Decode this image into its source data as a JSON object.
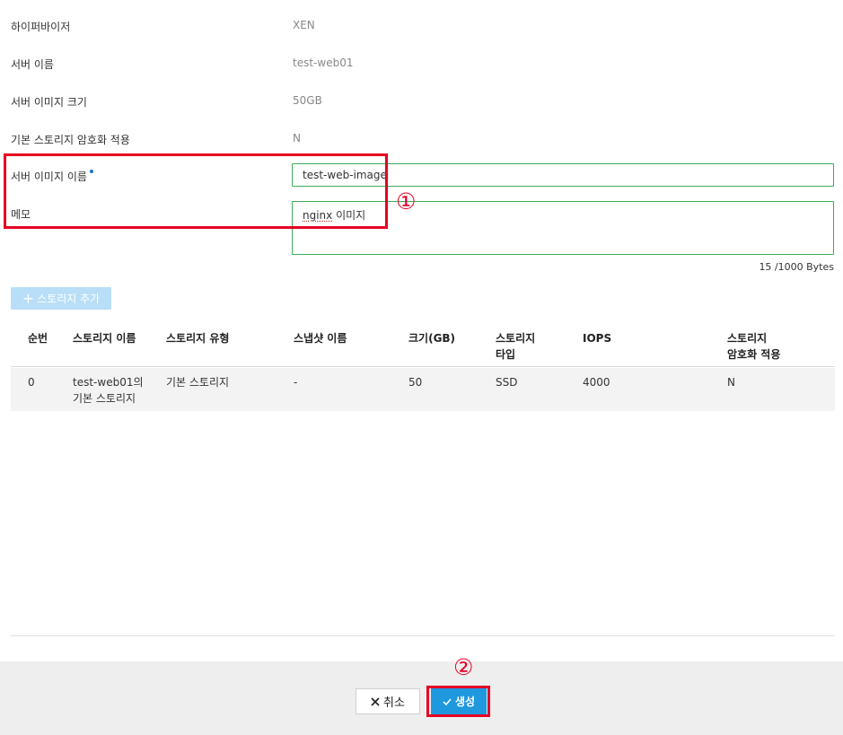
{
  "details": [
    {
      "label": "하이퍼바이저",
      "value": "XEN"
    },
    {
      "label": "서버 이름",
      "value": "test-web01"
    },
    {
      "label": "서버 이미지 크기",
      "value": "50GB"
    },
    {
      "label": "기본 스토리지 암호화 적용",
      "value": "N"
    }
  ],
  "form": {
    "image_name_label": "서버 이미지 이름",
    "image_name_value": "test-web-image",
    "memo_label": "메모",
    "memo_value_word": "nginx",
    "memo_value_rest": " 이미지",
    "byte_counter": "15 /1000 Bytes"
  },
  "add_storage_label": "스토리지 추가",
  "table": {
    "headers": [
      [
        "순번"
      ],
      [
        "스토리지 이름"
      ],
      [
        "스토리지 유형"
      ],
      [
        "스냅샷 이름"
      ],
      [
        "크기(GB)"
      ],
      [
        "스토리지",
        "타입"
      ],
      [
        "IOPS"
      ],
      [
        "스토리지",
        "암호화 적용"
      ]
    ],
    "rows": [
      {
        "cells": [
          [
            "0"
          ],
          [
            "test-web01의",
            "기본 스토리지"
          ],
          [
            "기본 스토리지"
          ],
          [
            "-"
          ],
          [
            "50"
          ],
          [
            "SSD"
          ],
          [
            "4000"
          ],
          [
            "N"
          ]
        ]
      }
    ]
  },
  "footer": {
    "cancel_label": "취소",
    "create_label": "생성"
  },
  "annotations": {
    "first": "①",
    "second": "②",
    "color": "#e60023"
  },
  "colors": {
    "accent": "#1f98de",
    "input_border": "#3fae5a",
    "required_dot": "#1a73c9"
  }
}
